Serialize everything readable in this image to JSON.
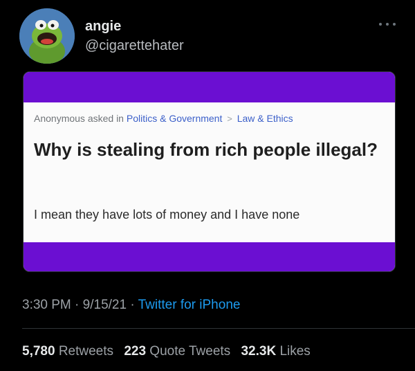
{
  "author": {
    "display_name": "angie",
    "handle": "@cigarettehater"
  },
  "card": {
    "asker": "Anonymous asked in",
    "category": "Politics & Government",
    "separator": ">",
    "subcategory": "Law & Ethics",
    "question": "Why is stealing from rich people illegal?",
    "detail": "I mean they have lots of money and I have none"
  },
  "meta": {
    "time": "3:30 PM",
    "dot1": "·",
    "date": "9/15/21",
    "dot2": "·",
    "source": "Twitter for iPhone"
  },
  "stats": {
    "retweets_count": "5,780",
    "retweets_label": "Retweets",
    "quotes_count": "223",
    "quotes_label": "Quote Tweets",
    "likes_count": "32.3K",
    "likes_label": "Likes"
  },
  "colors": {
    "background": "#000000",
    "accent_link": "#1d9bf0",
    "card_band": "#6b0fd2"
  }
}
